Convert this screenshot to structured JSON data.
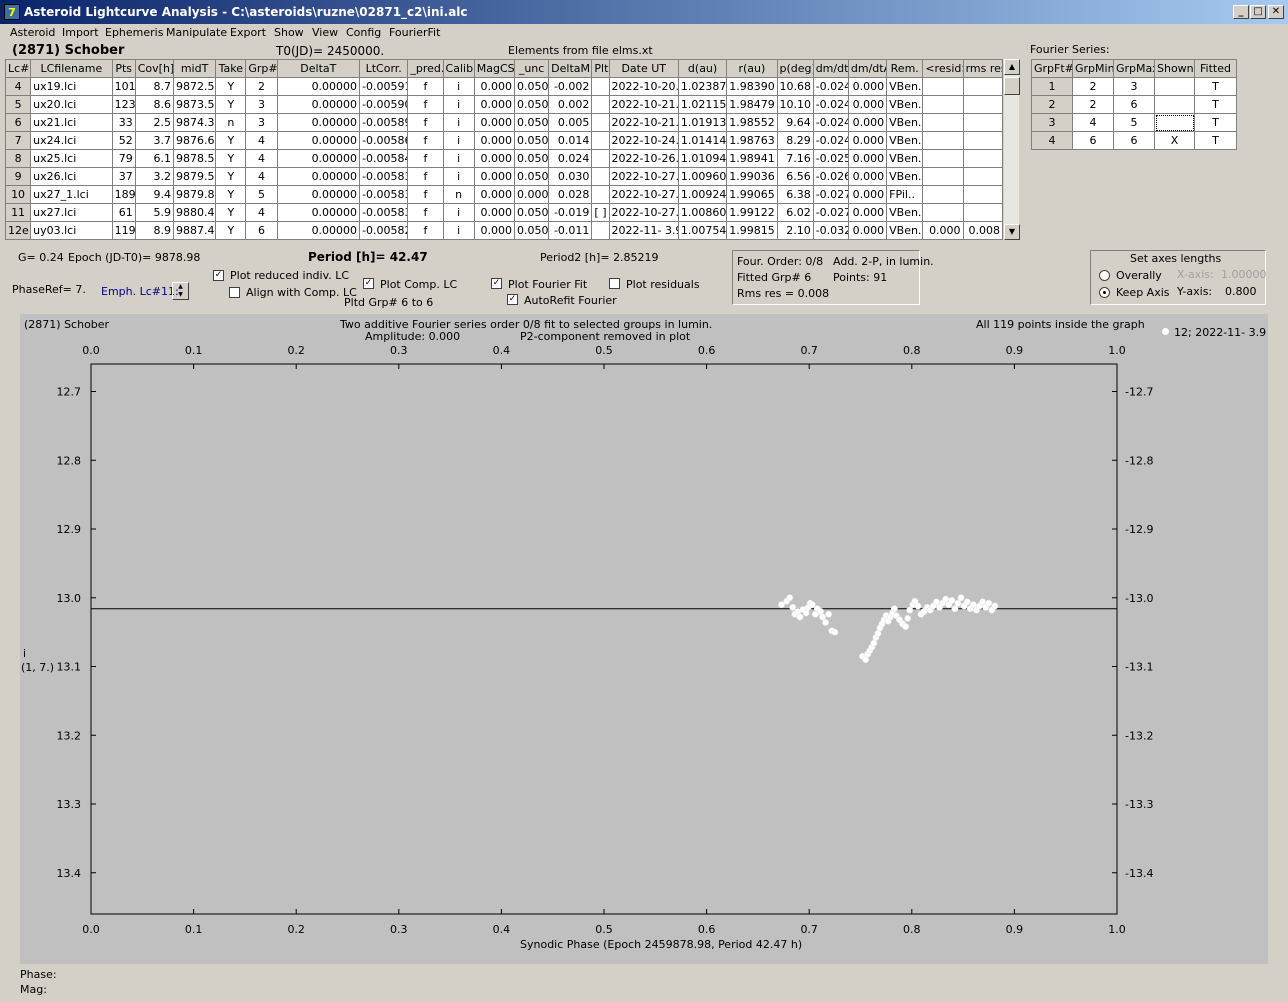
{
  "window": {
    "title": "Asteroid Lightcurve Analysis - C:\\asteroids\\ruzne\\02871_c2\\ini.alc",
    "minimize": "_",
    "maximize": "□",
    "close": "✕"
  },
  "menu": [
    "Asteroid",
    "Import",
    "Ephemeris",
    "Manipulate",
    "Export",
    "Show",
    "View",
    "Config",
    "FourierFit"
  ],
  "header": {
    "asteroid": "(2871) Schober",
    "t0": "T0(JD)= 2450000.",
    "elements": "Elements from file elms.xt",
    "fourier_label": "Fourier Series:"
  },
  "lc_table": {
    "columns": [
      "Lc#",
      "LCfilename",
      "Pts",
      "Cov[h]",
      "midT",
      "Take",
      "Grp#",
      "DeltaT",
      "LtCorr.",
      "_pred.",
      "Calib.",
      "MagCS",
      "_unc",
      "DeltaM",
      "Plt",
      "Date UT",
      "d(au)",
      "r(au)",
      "p(deg)",
      "dm/dt",
      "dm/dtA",
      "Rem.",
      "<resid>",
      "rms res"
    ],
    "rows": [
      [
        "4",
        "ux19.lci",
        "101",
        "8.7",
        "9872.5",
        "Y",
        "2",
        "0.00000",
        "-0.00591",
        "f",
        "i",
        "0.000",
        "0.050",
        "-0.002",
        "",
        "2022-10-20.0",
        "1.02387",
        "1.98390",
        "10.68",
        "-0.024",
        "0.000",
        "VBen..",
        "",
        ""
      ],
      [
        "5",
        "ux20.lci",
        "123",
        "8.6",
        "9873.5",
        "Y",
        "3",
        "0.00000",
        "-0.00590",
        "f",
        "i",
        "0.000",
        "0.050",
        "0.002",
        "",
        "2022-10-21.0",
        "1.02115",
        "1.98479",
        "10.10",
        "-0.024",
        "0.000",
        "VBen..",
        "",
        ""
      ],
      [
        "6",
        "ux21.lci",
        "33",
        "2.5",
        "9874.3",
        "n",
        "3",
        "0.00000",
        "-0.00589",
        "f",
        "i",
        "0.000",
        "0.050",
        "0.005",
        "",
        "2022-10-21.8",
        "1.01913",
        "1.98552",
        "9.64",
        "-0.024",
        "0.000",
        "VBen..",
        "",
        ""
      ],
      [
        "7",
        "ux24.lci",
        "52",
        "3.7",
        "9876.6",
        "Y",
        "4",
        "0.00000",
        "-0.00586",
        "f",
        "i",
        "0.000",
        "0.050",
        "0.014",
        "",
        "2022-10-24.1",
        "1.01414",
        "1.98763",
        "8.29",
        "-0.024",
        "0.000",
        "VBen..",
        "",
        ""
      ],
      [
        "8",
        "ux25.lci",
        "79",
        "6.1",
        "9878.5",
        "Y",
        "4",
        "0.00000",
        "-0.00584",
        "f",
        "i",
        "0.000",
        "0.050",
        "0.024",
        "",
        "2022-10-26.0",
        "1.01094",
        "1.98941",
        "7.16",
        "-0.025",
        "0.000",
        "VBen..",
        "",
        ""
      ],
      [
        "9",
        "ux26.lci",
        "37",
        "3.2",
        "9879.5",
        "Y",
        "4",
        "0.00000",
        "-0.00583",
        "f",
        "i",
        "0.000",
        "0.050",
        "0.030",
        "",
        "2022-10-27.0",
        "1.00960",
        "1.99036",
        "6.56",
        "-0.026",
        "0.000",
        "VBen..",
        "",
        ""
      ],
      [
        "10",
        "ux27_1.lci",
        "189",
        "9.4",
        "9879.8",
        "Y",
        "5",
        "0.00000",
        "-0.00583",
        "f",
        "n",
        "0.000",
        "0.000",
        "0.028",
        "",
        "2022-10-27.3",
        "1.00924",
        "1.99065",
        "6.38",
        "-0.027",
        "0.000",
        "FPil..",
        "",
        ""
      ],
      [
        "11",
        "ux27.lci",
        "61",
        "5.9",
        "9880.4",
        "Y",
        "4",
        "0.00000",
        "-0.00583",
        "f",
        "i",
        "0.000",
        "0.050",
        "-0.019",
        "[ ]",
        "2022-10-27.9",
        "1.00860",
        "1.99122",
        "6.02",
        "-0.027",
        "0.000",
        "VBen..",
        "",
        ""
      ],
      [
        "12e",
        "uy03.lci",
        "119",
        "8.9",
        "9887.4",
        "Y",
        "6",
        "0.00000",
        "-0.00582",
        "f",
        "i",
        "0.000",
        "0.050",
        "-0.011",
        "",
        "2022-11- 3.9",
        "1.00754",
        "1.99815",
        "2.10",
        "-0.032",
        "0.000",
        "VBen..",
        "0.000",
        "0.008"
      ]
    ]
  },
  "fourier_table": {
    "columns": [
      "GrpFt#",
      "GrpMin",
      "GrpMax",
      "Shown",
      "Fitted"
    ],
    "rows": [
      [
        "1",
        "2",
        "3",
        "",
        "T"
      ],
      [
        "2",
        "2",
        "6",
        "",
        "T"
      ],
      [
        "3",
        "4",
        "5",
        "",
        "T"
      ],
      [
        "4",
        "6",
        "6",
        "X",
        "T"
      ]
    ]
  },
  "controls": {
    "g": "G= 0.24",
    "epoch": "Epoch (JD-T0)= 9878.98",
    "period": "Period [h]= 42.47",
    "period2": "Period2 [h]= 2.85219",
    "phaseref": "PhaseRef= 7.",
    "emph": "Emph. Lc#11:",
    "plot_reduced": "Plot reduced indiv. LC",
    "align_comp": "Align with Comp. LC",
    "plot_comp": "Plot Comp. LC",
    "pltd_grp": "Pltd Grp#  6  to  6",
    "plot_fourier": "Plot Fourier Fit",
    "autorefit": "AutoRefit Fourier",
    "plot_residuals": "Plot residuals",
    "check_mark": "✓"
  },
  "fit_info": {
    "order": "Four. Order:  0/8",
    "add": "Add. 2-P, in lumin.",
    "fitted": "Fitted Grp# 6",
    "points": "Points: 91",
    "rms": "Rms res     = 0.008"
  },
  "axes_panel": {
    "title": "Set axes lengths",
    "overally": "Overally",
    "keep": "Keep Axis",
    "xaxis_label": "X-axis:",
    "xaxis_value": "1.00000",
    "yaxis_label": "Y-axis:",
    "yaxis_value": "0.800"
  },
  "plot": {
    "name": "(2871) Schober",
    "desc1": "Two additive Fourier series order 0/8 fit to selected groups in lumin.",
    "desc2": "Amplitude: 0.000",
    "desc3": "P2-component removed in plot",
    "all_points": "All 119 points inside the graph",
    "legend": "12; 2022-11- 3.9",
    "ylabel1": "i",
    "ylabel2": "(1, 7.)",
    "xlabel": "Synodic Phase (Epoch 2459878.98, Period 42.47 h)"
  },
  "status": {
    "phase": "Phase:",
    "mag": "Mag:"
  },
  "chart_data": {
    "type": "scatter",
    "xlim": [
      0.0,
      1.0
    ],
    "ylim": [
      12.66,
      13.46
    ],
    "y_inverted": true,
    "xticks": [
      "0.0",
      "0.1",
      "0.2",
      "0.3",
      "0.4",
      "0.5",
      "0.6",
      "0.7",
      "0.8",
      "0.9",
      "1.0"
    ],
    "yticks": [
      "12.7",
      "12.8",
      "12.9",
      "13.0",
      "13.1",
      "13.2",
      "13.3",
      "13.4"
    ],
    "fit_line": 13.016,
    "series": [
      {
        "name": "12; 2022-11- 3.9",
        "points": [
          [
            0.673,
            13.01
          ],
          [
            0.678,
            13.005
          ],
          [
            0.681,
            13.0
          ],
          [
            0.684,
            13.014
          ],
          [
            0.686,
            13.024
          ],
          [
            0.689,
            13.02
          ],
          [
            0.691,
            13.028
          ],
          [
            0.694,
            13.017
          ],
          [
            0.697,
            13.022
          ],
          [
            0.699,
            13.014
          ],
          [
            0.701,
            13.008
          ],
          [
            0.703,
            13.01
          ],
          [
            0.706,
            13.024
          ],
          [
            0.708,
            13.016
          ],
          [
            0.711,
            13.02
          ],
          [
            0.713,
            13.028
          ],
          [
            0.716,
            13.036
          ],
          [
            0.719,
            13.024
          ],
          [
            0.722,
            13.048
          ],
          [
            0.725,
            13.05
          ],
          [
            0.752,
            13.085
          ],
          [
            0.755,
            13.09
          ],
          [
            0.757,
            13.082
          ],
          [
            0.759,
            13.077
          ],
          [
            0.761,
            13.072
          ],
          [
            0.763,
            13.066
          ],
          [
            0.765,
            13.058
          ],
          [
            0.767,
            13.052
          ],
          [
            0.769,
            13.044
          ],
          [
            0.771,
            13.038
          ],
          [
            0.773,
            13.032
          ],
          [
            0.775,
            13.026
          ],
          [
            0.777,
            13.034
          ],
          [
            0.779,
            13.028
          ],
          [
            0.781,
            13.022
          ],
          [
            0.783,
            13.016
          ],
          [
            0.785,
            13.026
          ],
          [
            0.788,
            13.032
          ],
          [
            0.791,
            13.038
          ],
          [
            0.794,
            13.042
          ],
          [
            0.796,
            13.03
          ],
          [
            0.798,
            13.018
          ],
          [
            0.801,
            13.01
          ],
          [
            0.803,
            13.005
          ],
          [
            0.806,
            13.012
          ],
          [
            0.809,
            13.024
          ],
          [
            0.812,
            13.02
          ],
          [
            0.815,
            13.014
          ],
          [
            0.818,
            13.018
          ],
          [
            0.821,
            13.012
          ],
          [
            0.824,
            13.006
          ],
          [
            0.827,
            13.014
          ],
          [
            0.83,
            13.008
          ],
          [
            0.833,
            13.002
          ],
          [
            0.836,
            13.01
          ],
          [
            0.839,
            13.004
          ],
          [
            0.842,
            13.016
          ],
          [
            0.845,
            13.008
          ],
          [
            0.848,
            13.0
          ],
          [
            0.851,
            13.012
          ],
          [
            0.854,
            13.006
          ],
          [
            0.857,
            13.016
          ],
          [
            0.86,
            13.01
          ],
          [
            0.863,
            13.018
          ],
          [
            0.866,
            13.012
          ],
          [
            0.869,
            13.006
          ],
          [
            0.872,
            13.014
          ],
          [
            0.875,
            13.008
          ],
          [
            0.878,
            13.018
          ],
          [
            0.881,
            13.012
          ]
        ]
      }
    ]
  }
}
